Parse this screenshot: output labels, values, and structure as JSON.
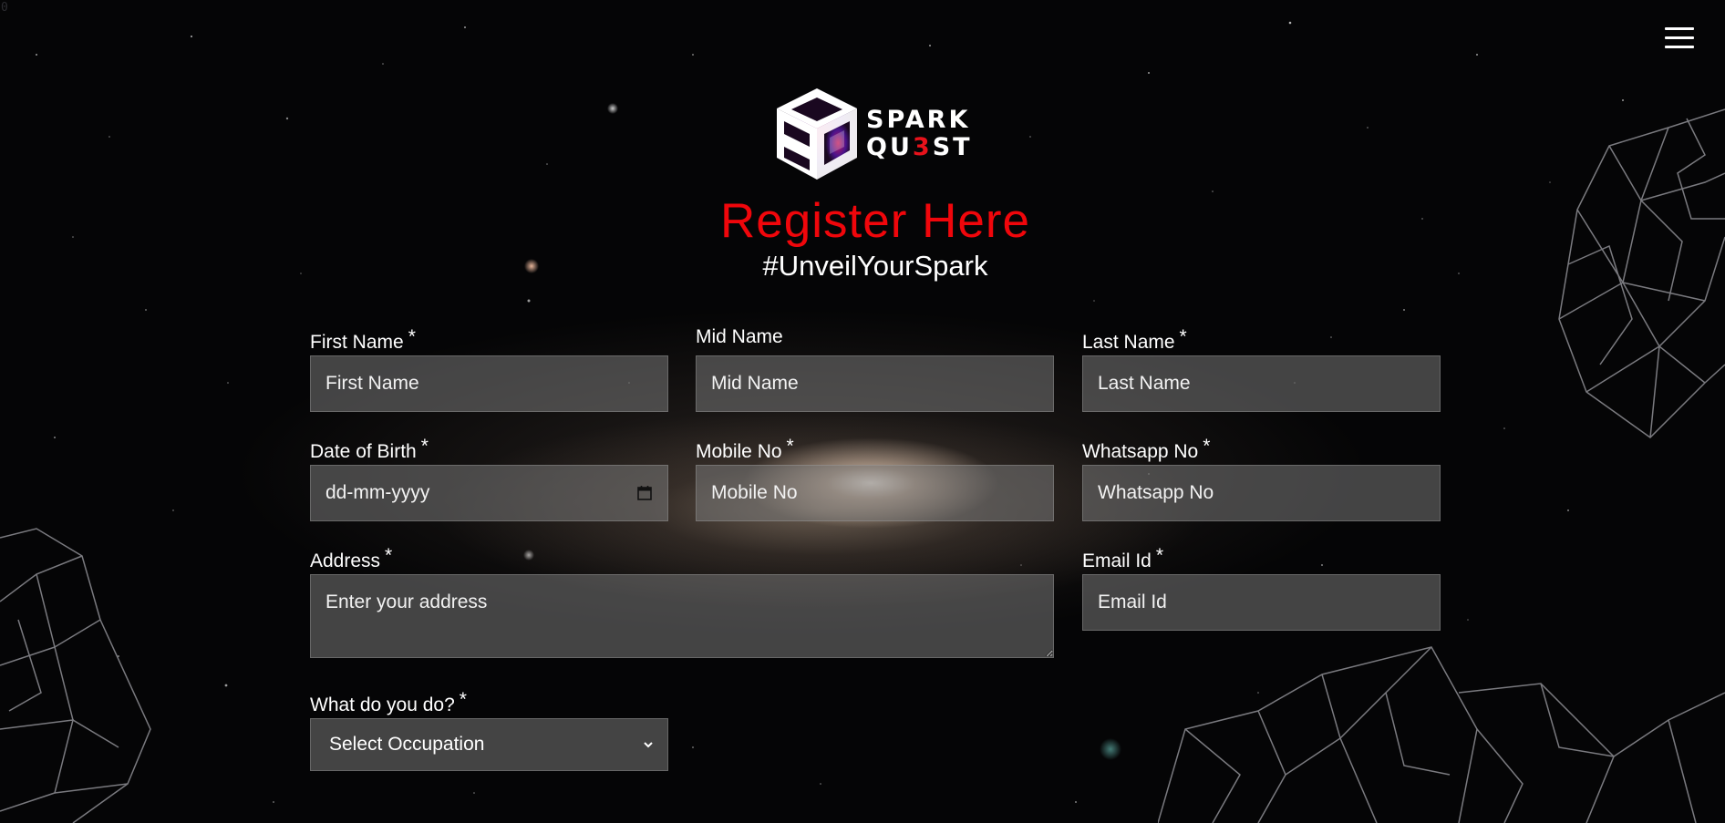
{
  "page": {
    "corner_digit": "0",
    "menu_icon": "hamburger-menu-icon"
  },
  "logo": {
    "mark_letters": "SQ3",
    "line1": "SPARK",
    "line2_a": "QU",
    "line2_b": "3",
    "line2_c": "ST"
  },
  "header": {
    "title": "Register Here",
    "subtitle": "#UnveilYourSpark"
  },
  "colors": {
    "title": "#f0060b",
    "text": "#ffffff",
    "field_bg": "rgba(120,120,120,0.55)"
  },
  "form": {
    "required_mark": "*",
    "first_name": {
      "label": "First Name",
      "placeholder": "First Name"
    },
    "mid_name": {
      "label": "Mid Name",
      "placeholder": "Mid Name"
    },
    "last_name": {
      "label": "Last Name",
      "placeholder": "Last Name"
    },
    "dob": {
      "label": "Date of Birth",
      "placeholder": "dd-mm-yyyy",
      "icon": "calendar-icon"
    },
    "mobile": {
      "label": "Mobile No",
      "placeholder": "Mobile No"
    },
    "whatsapp": {
      "label": "Whatsapp No",
      "placeholder": "Whatsapp No"
    },
    "address": {
      "label": "Address",
      "placeholder": "Enter your address"
    },
    "email": {
      "label": "Email Id",
      "placeholder": "Email Id"
    },
    "occupation": {
      "label": "What do you do?",
      "selected": "Select Occupation",
      "icon": "chevron-down-icon"
    }
  }
}
